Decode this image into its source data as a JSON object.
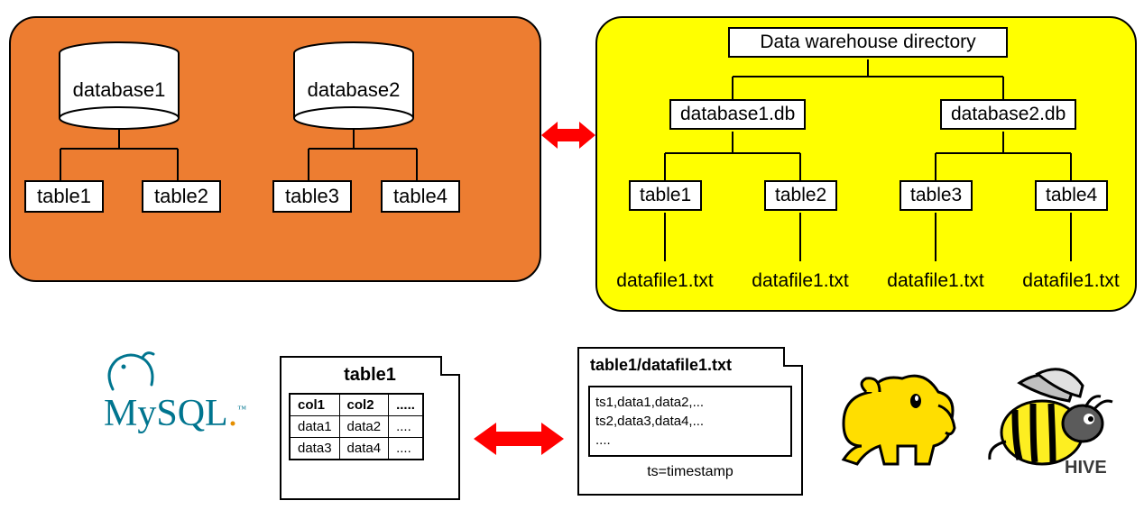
{
  "left": {
    "db1": "database1",
    "db2": "database2",
    "tables": [
      "table1",
      "table2",
      "table3",
      "table4"
    ]
  },
  "right": {
    "root": "Data warehouse directory",
    "db1": "database1.db",
    "db2": "database2.db",
    "tables": [
      "table1",
      "table2",
      "table3",
      "table4"
    ],
    "files": [
      "datafile1.txt",
      "datafile1.txt",
      "datafile1.txt",
      "datafile1.txt"
    ]
  },
  "mysql_doc": {
    "title": "table1",
    "cols": [
      "col1",
      "col2",
      "....."
    ],
    "r1": [
      "data1",
      "data2",
      "...."
    ],
    "r2": [
      "data3",
      "data4",
      "...."
    ]
  },
  "hive_doc": {
    "title": "table1/datafile1.txt",
    "lines": "ts1,data1,data2,...\nts2,data3,data4,...\n....",
    "ts": "ts=timestamp"
  },
  "logos": {
    "mysql": "MySQL",
    "hive": "HIVE"
  }
}
